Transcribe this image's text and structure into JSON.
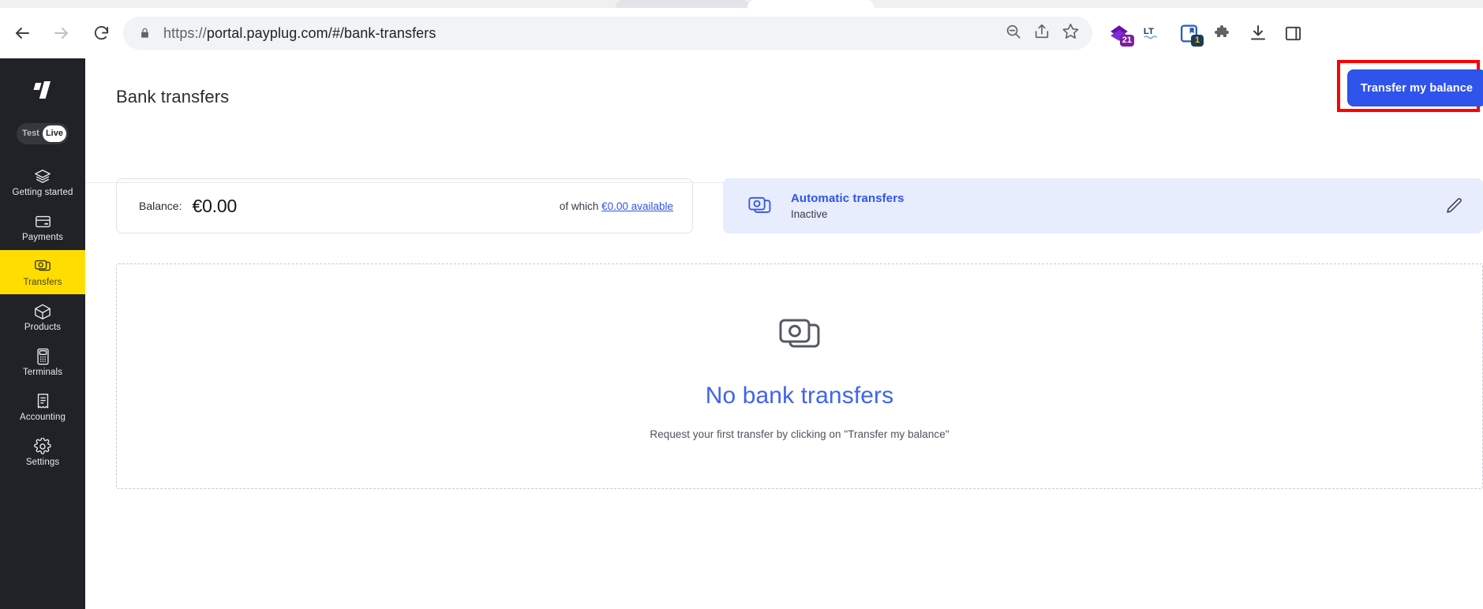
{
  "browser": {
    "back_icon": "arrow-left-icon",
    "forward_icon": "arrow-right-icon",
    "reload_icon": "reload-icon",
    "lock_icon": "lock-icon",
    "url_scheme": "https://",
    "url_rest": "portal.payplug.com/#/bank-transfers",
    "url_full": "https://portal.payplug.com/#/bank-transfers",
    "actions": [
      {
        "name": "zoom-out-icon",
        "label": ""
      },
      {
        "name": "share-icon",
        "label": ""
      },
      {
        "name": "bookmark-star-icon",
        "label": ""
      }
    ],
    "extensions": [
      {
        "name": "grammar-extension-icon",
        "badge": "21"
      },
      {
        "name": "languagetool-extension-icon",
        "badge": ""
      },
      {
        "name": "reader-extension-icon",
        "badge": "1"
      },
      {
        "name": "puzzle-extensions-icon",
        "badge": ""
      },
      {
        "name": "downloads-icon",
        "badge": ""
      },
      {
        "name": "side-panel-icon",
        "badge": ""
      }
    ]
  },
  "sidebar": {
    "logo": "payplug-logo",
    "env_toggle": {
      "test_label": "Test",
      "live_label": "Live",
      "selected": "Live"
    },
    "items": [
      {
        "label": "Getting started",
        "icon": "layers-icon",
        "active": false
      },
      {
        "label": "Payments",
        "icon": "credit-card-icon",
        "active": false
      },
      {
        "label": "Transfers",
        "icon": "banknotes-icon",
        "active": true
      },
      {
        "label": "Products",
        "icon": "box-icon",
        "active": false
      },
      {
        "label": "Terminals",
        "icon": "payment-terminal-icon",
        "active": false
      },
      {
        "label": "Accounting",
        "icon": "receipt-icon",
        "active": false
      },
      {
        "label": "Settings",
        "icon": "gear-icon",
        "active": false
      }
    ]
  },
  "header": {
    "title": "Bank transfers",
    "transfer_button_label": "Transfer my balance"
  },
  "balance_card": {
    "label": "Balance:",
    "amount": "€0.00",
    "available_prefix": "of which ",
    "available_link": "€0.00 available"
  },
  "automatic_transfers": {
    "icon": "banknotes-icon",
    "title": "Automatic transfers",
    "status": "Inactive",
    "edit_icon": "pencil-edit-icon"
  },
  "empty_state": {
    "icon": "banknotes-icon",
    "title": "No bank transfers",
    "subtitle": "Request your first transfer by clicking on \"Transfer my balance\""
  },
  "colors": {
    "sidebar_bg": "#212227",
    "active_nav": "#ffdd00",
    "primary_blue": "#2f54eb",
    "empty_title_blue": "#3f63f3",
    "card_bg_blue": "#e8edfd",
    "annotation_red": "#ff0000"
  }
}
